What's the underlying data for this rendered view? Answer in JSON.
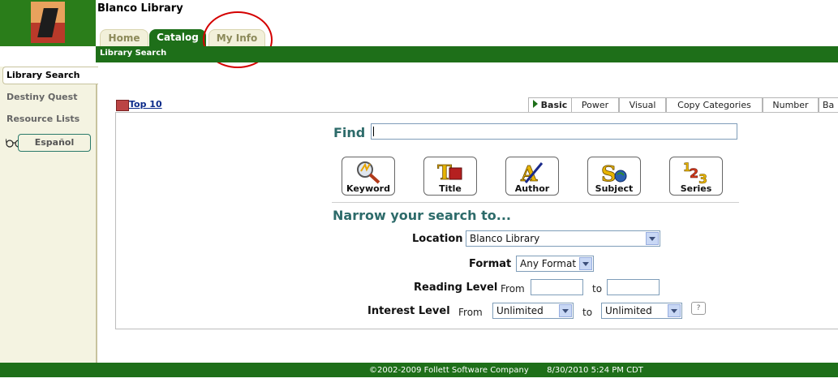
{
  "app_title": "Blanco Library",
  "tabs": {
    "home": "Home",
    "catalog": "Catalog",
    "my_info": "My Info"
  },
  "subnav": {
    "current": "Library Search"
  },
  "sidebar": {
    "items": [
      "Library Search",
      "Destiny Quest",
      "Resource Lists"
    ],
    "espanol_button": "Español"
  },
  "top10_link": "Top 10",
  "search_tabs": [
    "Basic",
    "Power",
    "Visual",
    "Copy Categories",
    "Number",
    "Ba"
  ],
  "find": {
    "label": "Find",
    "value": ""
  },
  "search_buttons": [
    {
      "label": "Keyword",
      "icon": "magnifier-icon"
    },
    {
      "label": "Title",
      "icon": "title-book-icon"
    },
    {
      "label": "Author",
      "icon": "author-pen-icon"
    },
    {
      "label": "Subject",
      "icon": "subject-globe-icon"
    },
    {
      "label": "Series",
      "icon": "series-123-icon"
    }
  ],
  "narrow": {
    "title": "Narrow your search to...",
    "location_label": "Location",
    "location_value": "Blanco Library",
    "format_label": "Format",
    "format_value": "Any Format",
    "reading_level_label": "Reading Level",
    "from_label": "From",
    "to_label": "to",
    "interest_level_label": "Interest Level",
    "interest_from_value": "Unlimited",
    "interest_to_value": "Unlimited",
    "help_symbol": "?"
  },
  "footer": {
    "copyright": "©2002-2009  Follett Software Company",
    "timestamp": "8/30/2010 5:24 PM CDT"
  },
  "colors": {
    "brand_green": "#1e6f19",
    "heading_teal": "#2d6b6a",
    "highlight_circle": "#d40000"
  }
}
